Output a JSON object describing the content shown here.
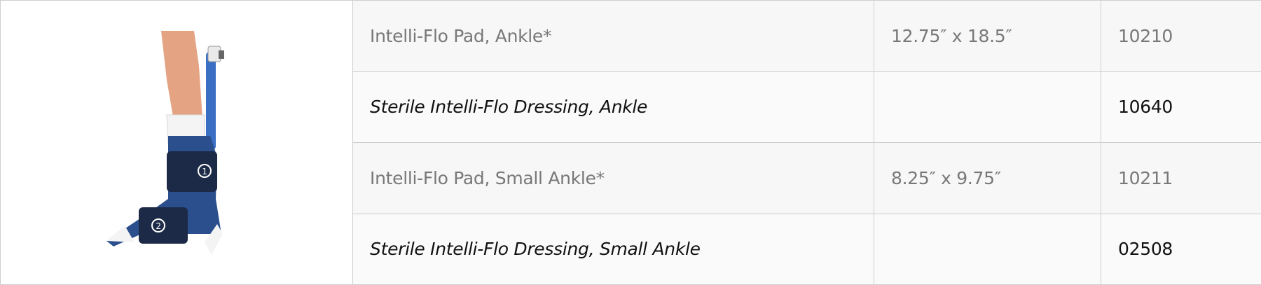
{
  "table": {
    "image": {
      "icon": "ankle-wrap-icon",
      "strap_labels": [
        "1",
        "2"
      ],
      "colors": {
        "wrap": "#2a4f8c",
        "strap": "#1c2a47",
        "skin": "#e4a484",
        "sock": "#f4f4f4",
        "tube": "#3a6fc4"
      }
    },
    "rows": [
      {
        "name": "Intelli-Flo Pad, Ankle*",
        "size": "12.75″ x 18.5″",
        "code": "10210"
      },
      {
        "name": "Sterile Intelli-Flo Dressing, Ankle",
        "size": "",
        "code": "10640"
      },
      {
        "name": "Intelli-Flo Pad, Small Ankle*",
        "size": "8.25″ x 9.75″",
        "code": "10211"
      },
      {
        "name": "Sterile Intelli-Flo Dressing, Small Ankle",
        "size": "",
        "code": "02508"
      }
    ]
  }
}
